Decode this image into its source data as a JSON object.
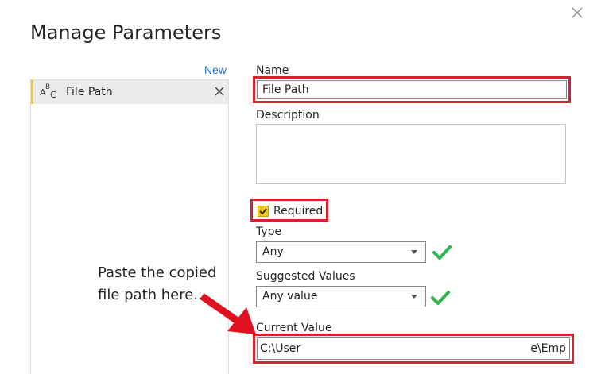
{
  "dialog": {
    "title": "Manage Parameters",
    "close_icon": "close-icon"
  },
  "sidebar": {
    "new_label": "New",
    "items": [
      {
        "label": "File Path",
        "type_icon": "abc-text-type-icon",
        "type_icon_text": "ABC",
        "remove_icon": "remove-icon",
        "selected": true
      }
    ]
  },
  "form": {
    "name": {
      "label": "Name",
      "value": "File Path"
    },
    "description": {
      "label": "Description",
      "value": ""
    },
    "required": {
      "label": "Required",
      "checked": true
    },
    "type": {
      "label": "Type",
      "value": "Any"
    },
    "suggested_values": {
      "label": "Suggested Values",
      "value": "Any value"
    },
    "current_value": {
      "label": "Current Value",
      "value_start": "C:\\User",
      "value_end": "e\\Emp"
    }
  },
  "annotation": {
    "line1": "Paste the copied",
    "line2": "file path here...."
  },
  "colors": {
    "accent": "#f2c811",
    "highlight_box": "#d4232d",
    "link": "#1a73c8",
    "check": "#2db84d"
  }
}
